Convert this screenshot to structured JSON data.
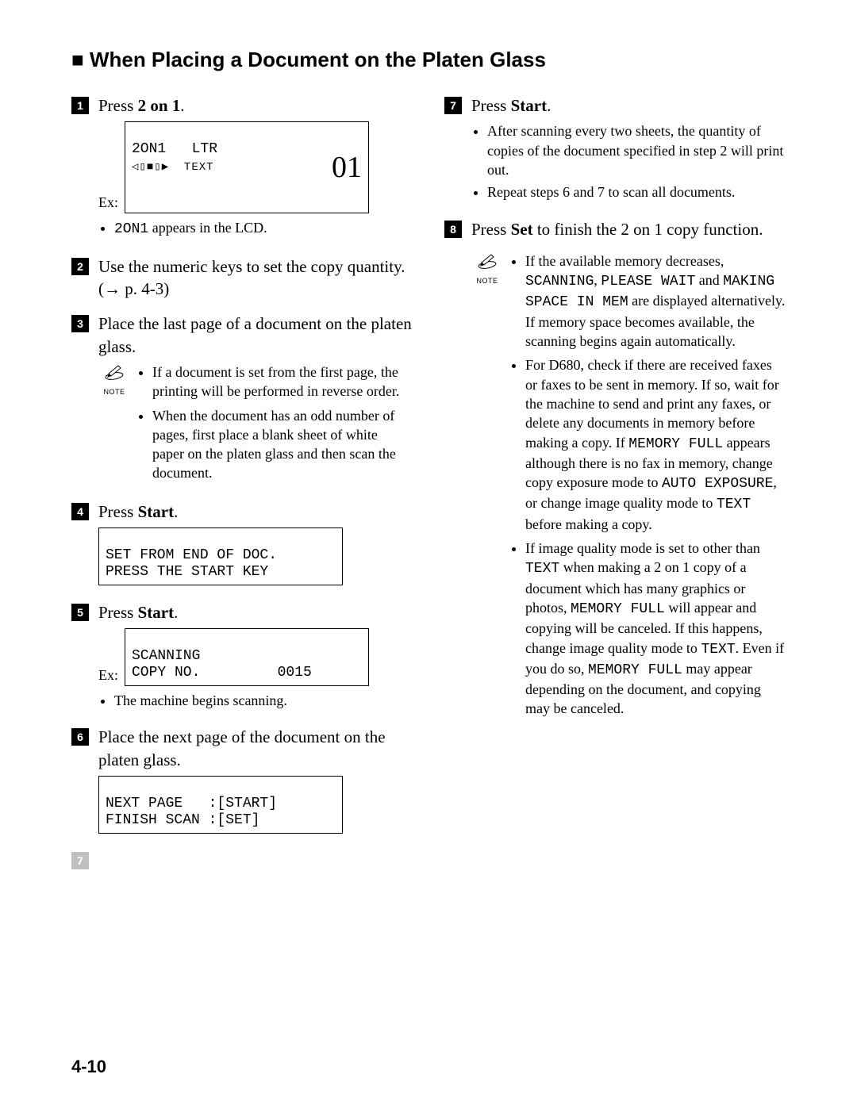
{
  "section_title": "When Placing a Document on the Platen Glass",
  "page_number": "4-10",
  "left": {
    "step1": {
      "num": "1",
      "text_a": "Press ",
      "text_b": "2 on 1",
      "text_c": ".",
      "ex_label": "Ex:",
      "lcd_line1": "2ON1   LTR",
      "lcd_line2_left": "◁▯■▯▶  TEXT",
      "lcd_big": "01",
      "bullet1_a": "2ON1",
      "bullet1_b": " appears in the LCD."
    },
    "step2": {
      "num": "2",
      "text_a": "Use the numeric keys to set the copy quantity. (",
      "ref": "p. 4-3",
      "text_b": ")"
    },
    "step3": {
      "num": "3",
      "text": "Place the last page of a document on the platen glass.",
      "note_label": "NOTE",
      "note_b1": "If a document is set from the first page, the printing will be performed in reverse order.",
      "note_b2": "When the document has an odd number of pages, first place a blank sheet of white paper on the platen glass and then scan the document."
    },
    "step4": {
      "num": "4",
      "text_a": "Press ",
      "text_b": "Start",
      "text_c": ".",
      "lcd_line1": "SET FROM END OF DOC.",
      "lcd_line2": "PRESS THE START KEY"
    },
    "step5": {
      "num": "5",
      "text_a": "Press ",
      "text_b": "Start",
      "text_c": ".",
      "ex_label": "Ex:",
      "lcd_line1": "SCANNING",
      "lcd_line2": "COPY NO.         0015",
      "bullet1": "The machine begins scanning."
    },
    "step6": {
      "num": "6",
      "text": "Place the next page of the document on the platen glass.",
      "lcd_line1": "NEXT PAGE   :[START]",
      "lcd_line2": "FINISH SCAN :[SET]"
    },
    "ghost_num": "7"
  },
  "right": {
    "step7": {
      "num": "7",
      "text_a": "Press ",
      "text_b": "Start",
      "text_c": ".",
      "bullet1": "After scanning every two sheets, the quantity of copies of the document specified in step 2 will print out.",
      "bullet2": "Repeat steps 6 and 7 to scan all documents."
    },
    "step8": {
      "num": "8",
      "text_a": "Press ",
      "text_b": "Set",
      "text_c": " to finish the 2 on 1 copy function.",
      "note_label": "NOTE",
      "n1_a": "If the available memory decreases, ",
      "n1_b": "SCANNING",
      "n1_c": ", ",
      "n1_d": "PLEASE WAIT",
      "n1_e": " and ",
      "n1_f": "MAKING SPACE IN MEM",
      "n1_g": " are displayed alternatively. If memory space becomes available, the scanning begins again automatically.",
      "n2_a": "For D680, check if there are received faxes or faxes to be sent in memory. If so, wait for the machine to send and print any faxes, or delete any documents in memory before making a copy. If ",
      "n2_b": "MEMORY FULL",
      "n2_c": " appears although there is no fax in memory, change copy exposure mode to ",
      "n2_d": "AUTO EXPOSURE",
      "n2_e": ", or change image quality mode to ",
      "n2_f": "TEXT",
      "n2_g": " before making a copy.",
      "n3_a": "If image quality mode is set to other than ",
      "n3_b": "TEXT",
      "n3_c": " when making a 2 on 1 copy of a document which has many graphics or photos, ",
      "n3_d": "MEMORY FULL",
      "n3_e": " will appear and copying will be canceled. If this happens, change image quality mode to ",
      "n3_f": "TEXT",
      "n3_g": ". Even if you do so, ",
      "n3_h": "MEMORY FULL",
      "n3_i": " may appear depending on the document, and copying may be canceled."
    }
  }
}
